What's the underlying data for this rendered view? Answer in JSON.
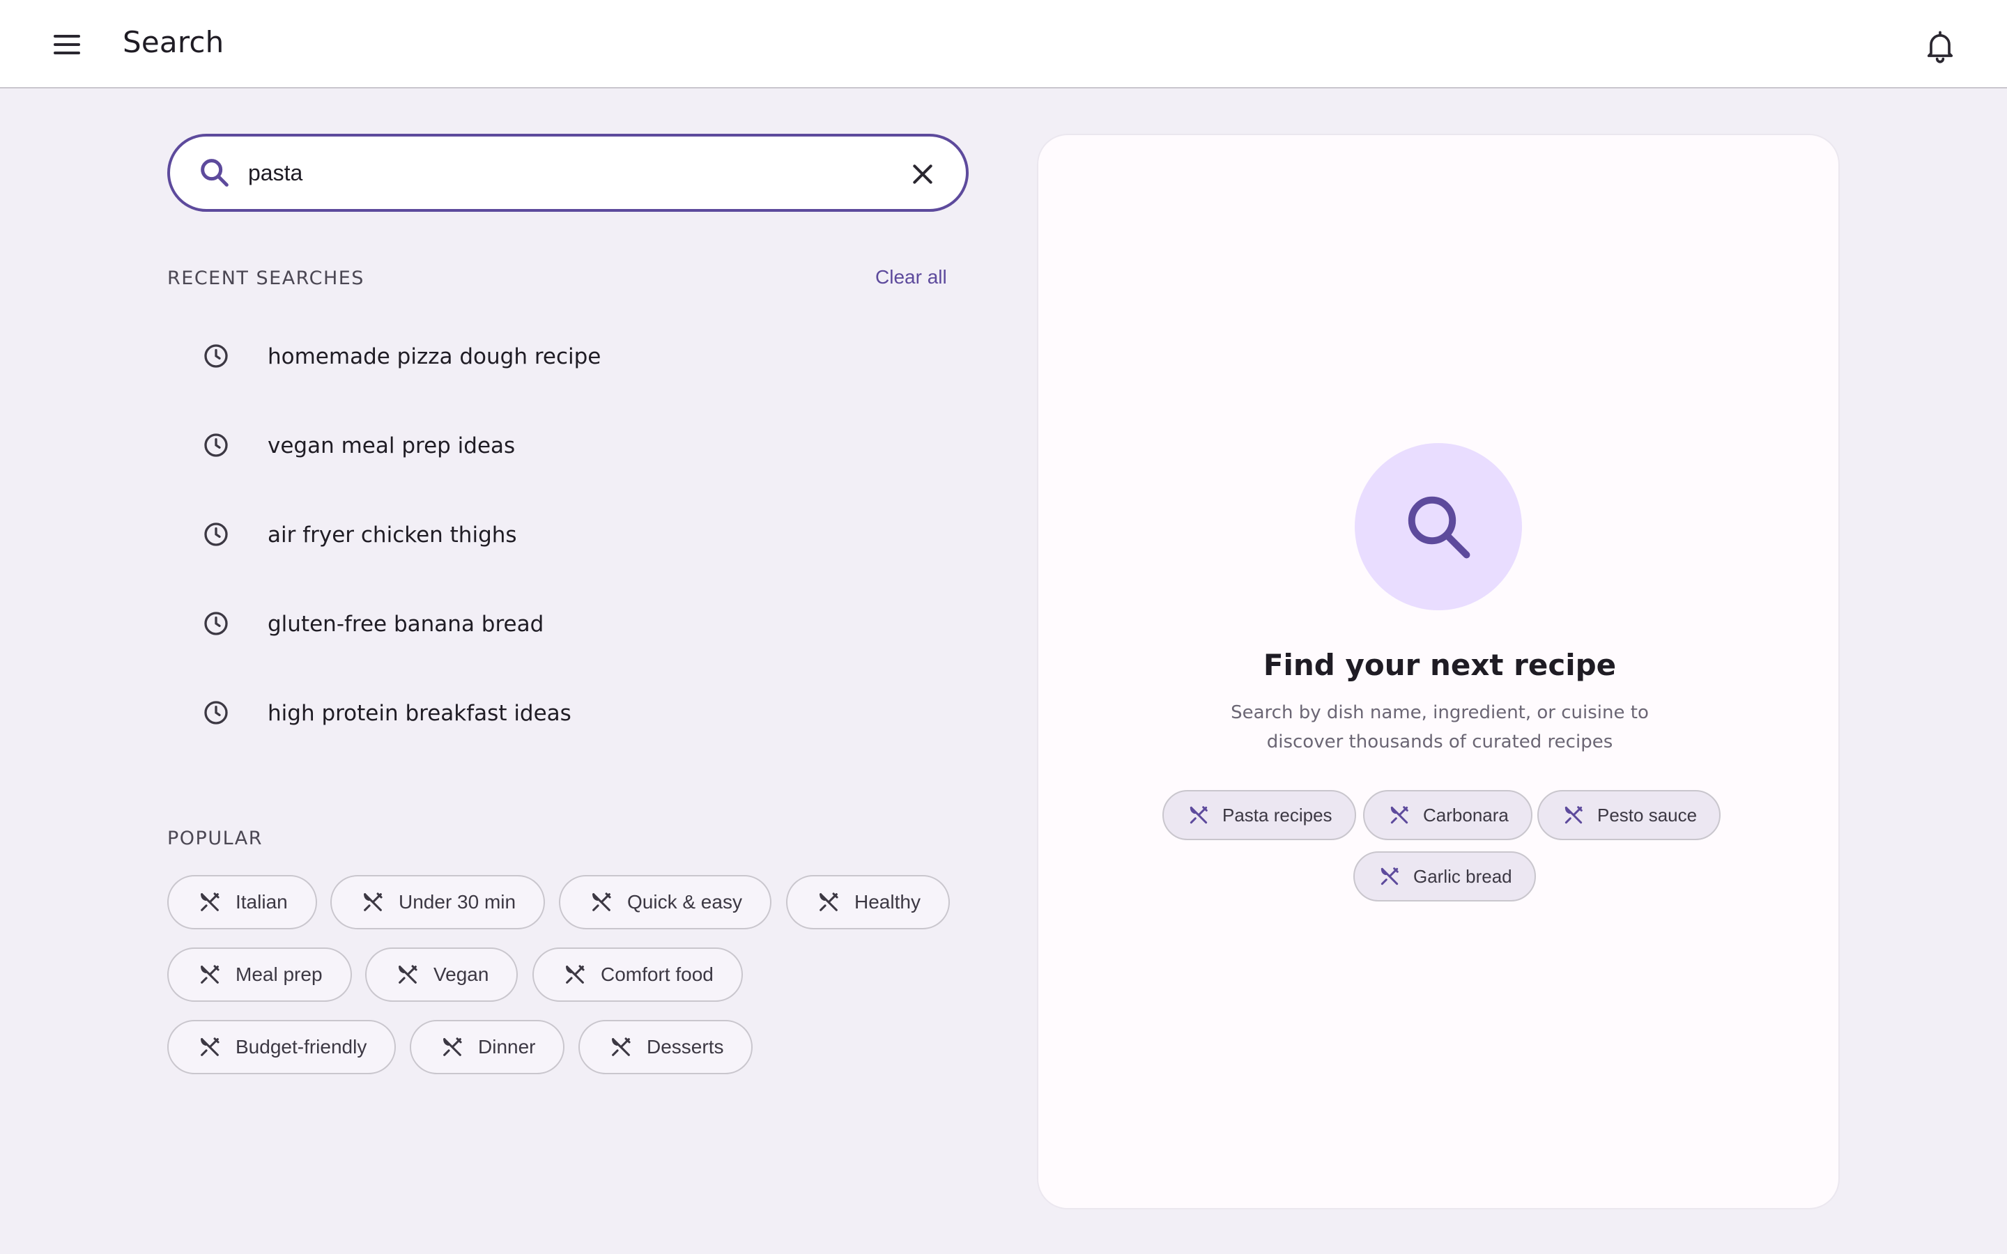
{
  "appbar": {
    "title": "Search",
    "menu_icon": "menu-icon",
    "notification_icon": "bell-icon"
  },
  "search": {
    "value": "pasta",
    "placeholder": "",
    "search_icon": "search-icon",
    "clear_icon": "close-icon"
  },
  "recent": {
    "heading": "RECENT SEARCHES",
    "clear_all": "Clear all",
    "item_icon": "clock-icon",
    "items": [
      "homemade pizza dough recipe",
      "vegan meal prep ideas",
      "air fryer chicken thighs",
      "gluten-free banana bread",
      "high protein breakfast ideas"
    ]
  },
  "popular": {
    "heading": "POPULAR",
    "chip_icon": "utensils-icon",
    "chips": [
      "Italian",
      "Under 30 min",
      "Quick & easy",
      "Healthy",
      "Meal prep",
      "Vegan",
      "Comfort food",
      "Budget-friendly",
      "Dinner",
      "Desserts"
    ]
  },
  "empty_state": {
    "icon": "search-icon",
    "title": "Find your next recipe",
    "subtitle": "Search by dish name, ingredient, or cuisine to discover thousands of curated recipes",
    "suggestions": [
      "Pasta recipes",
      "Carbonara",
      "Pesto sauce",
      "Garlic bread"
    ]
  },
  "colors": {
    "accent": "#5d4a9c",
    "background": "#f2eff6",
    "hero_circle": "#e9ddff"
  }
}
